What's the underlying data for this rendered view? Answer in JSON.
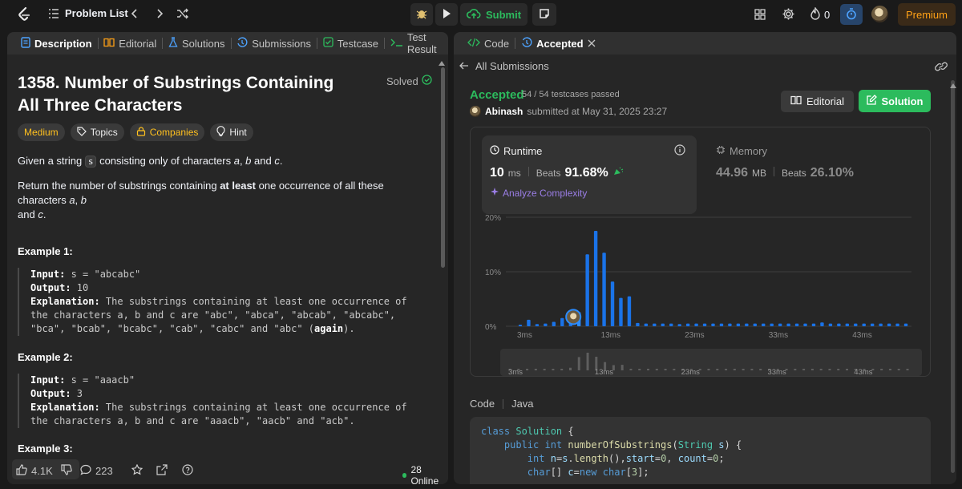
{
  "header": {
    "problem_list_label": "Problem List",
    "submit_label": "Submit",
    "streak_count": "0",
    "premium_label": "Premium"
  },
  "left_tabs": [
    {
      "label": "Description"
    },
    {
      "label": "Editorial"
    },
    {
      "label": "Solutions"
    },
    {
      "label": "Submissions"
    },
    {
      "label": "Testcase"
    },
    {
      "label": "Test Result"
    }
  ],
  "problem": {
    "title": "1358. Number of Substrings Containing All Three Characters",
    "solved_label": "Solved",
    "tags": {
      "difficulty": "Medium",
      "topics": "Topics",
      "companies": "Companies",
      "hint": "Hint"
    },
    "desc1_pre": "Given a string ",
    "desc1_code": "s",
    "desc1_post": " consisting only of characters ",
    "desc1_a": "a",
    "desc1_comma": ", ",
    "desc1_b": "b",
    "desc1_and": " and ",
    "desc1_c": "c",
    "desc1_end": ".",
    "desc2_pre": "Return the number of substrings containing ",
    "desc2_bold": "at least",
    "desc2_mid": " one occurrence of all these characters ",
    "desc2_a": "a",
    "desc2_comma": ", ",
    "desc2_b": "b",
    "desc2_and": "and ",
    "desc2_c": "c",
    "desc2_end": ".",
    "examples": [
      {
        "title": "Example 1:",
        "input_label": "Input:",
        "input": " s = \"abcabc\"",
        "output_label": "Output:",
        "output": " 10",
        "explanation_label": "Explanation:",
        "explanation_l1": " The substrings containing at least one occurrence of",
        "explanation_l2": "the characters a, b and c are \"abc\", \"abca\", \"abcab\", \"abcabc\",",
        "explanation_l3a": "\"bca\", \"bcab\", \"bcabc\", \"cab\", \"cabc\" and \"abc\" (",
        "explanation_l3b": "again",
        "explanation_l3c": ")."
      },
      {
        "title": "Example 2:",
        "input_label": "Input:",
        "input": " s = \"aaacb\"",
        "output_label": "Output:",
        "output": " 3",
        "explanation_label": "Explanation:",
        "explanation_l1": " The substrings containing at least one occurrence of",
        "explanation_l2": "the characters a, b and c are \"aaacb\", \"aacb\" and \"acb\"."
      },
      {
        "title": "Example 3:"
      }
    ]
  },
  "footer": {
    "likes": "4.1K",
    "comments": "223",
    "online": "28 Online"
  },
  "right_tabs": [
    {
      "label": "Code"
    },
    {
      "label": "Accepted"
    }
  ],
  "submission": {
    "all_submissions_label": "All Submissions",
    "status": "Accepted",
    "testcases": "54 / 54 testcases passed",
    "author": "Abinash",
    "submitted_at": " submitted at May 31, 2025 23:27",
    "editorial_label": "Editorial",
    "solution_label": "Solution",
    "runtime_label": "Runtime",
    "runtime_value": "10",
    "runtime_unit": "ms",
    "beats_label": "Beats",
    "runtime_beats": "91.68%",
    "analyze_label": "Analyze Complexity",
    "memory_label": "Memory",
    "memory_value": "44.96",
    "memory_unit": "MB",
    "memory_beats": "26.10%",
    "code_label": "Code",
    "language": "Java",
    "code_lines": [
      "class Solution {",
      "    public int numberOfSubstrings(String s) {",
      "        int n=s.length(),start=0, count=0;",
      "        char[] c=new char[3];"
    ]
  },
  "chart_data": {
    "type": "bar",
    "ylabel": "",
    "xlabel": "",
    "y_ticks": [
      "20%",
      "10%",
      "0%"
    ],
    "ylim": [
      0,
      20
    ],
    "x_tick_labels": [
      "3ms",
      "13ms",
      "23ms",
      "33ms",
      "43ms"
    ],
    "overview_tick_labels": [
      "3ms",
      "13ms",
      "23ms",
      "33ms",
      "43ms"
    ],
    "highlight_x": 10,
    "x": [
      3,
      4,
      5,
      6,
      7,
      8,
      9,
      10,
      11,
      12,
      13,
      14,
      15,
      16,
      17,
      18,
      19,
      20,
      21,
      22,
      23,
      24,
      25,
      26,
      27,
      28,
      29,
      30,
      31,
      32,
      33,
      34,
      35,
      36,
      37,
      38,
      39,
      40,
      41,
      42,
      43,
      44,
      45,
      46,
      47,
      48,
      49
    ],
    "values": [
      0.3,
      1.2,
      0.4,
      0.5,
      0.8,
      1.5,
      0.5,
      2.6,
      13.2,
      17.5,
      13.5,
      8.2,
      5.2,
      5.5,
      0.6,
      0.5,
      0.5,
      0.5,
      0.5,
      0.4,
      0.5,
      0.5,
      0.5,
      0.5,
      0.5,
      0.5,
      0.5,
      0.5,
      0.5,
      0.5,
      0.5,
      0.5,
      0.5,
      0.5,
      0.5,
      0.5,
      0.7,
      0.5,
      0.5,
      0.5,
      0.5,
      0.5,
      0.5,
      0.5,
      0.5,
      0.5,
      0.5
    ],
    "bar_color": "#1a73e8",
    "highlight_color": "#2b8cff"
  },
  "colors": {
    "accent_green": "#2cbb5d",
    "premium_orange": "#ffa116",
    "medium_yellow": "#ffc01e"
  }
}
